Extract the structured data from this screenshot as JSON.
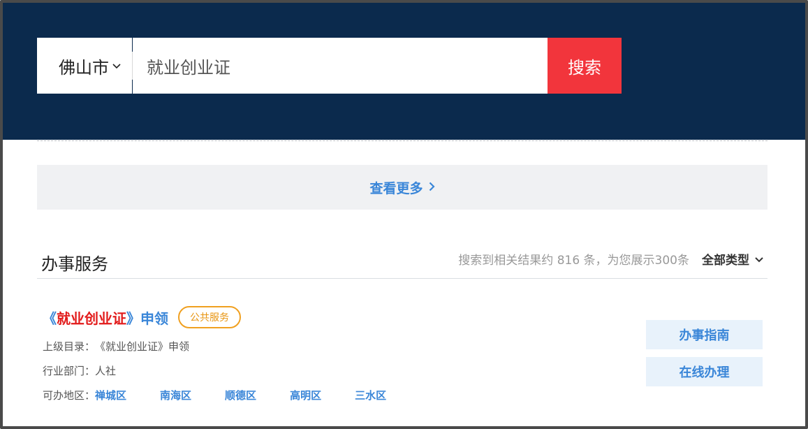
{
  "search": {
    "city": "佛山市",
    "query": "就业创业证",
    "button_label": "搜索"
  },
  "more": {
    "label": "查看更多"
  },
  "section": {
    "title": "办事服务",
    "result_summary": "搜索到相关结果约 816 条，为您展示300条",
    "type_filter": "全部类型"
  },
  "result": {
    "title_open": "《",
    "title_highlight": "就业创业证",
    "title_close": "》",
    "title_suffix": "申领",
    "tag": "公共服务",
    "parent_label": "上级目录：",
    "parent_value": "《就业创业证》申领",
    "dept_label": "行业部门：",
    "dept_value": "人社",
    "regions_label": "可办地区：",
    "regions": [
      "禅城区",
      "南海区",
      "顺德区",
      "高明区",
      "三水区"
    ],
    "guide_button": "办事指南",
    "online_button": "在线办理"
  },
  "colors": {
    "header_bg": "#0b2a4d",
    "search_button": "#f2353c",
    "link_blue": "#3a86d8",
    "highlight_red": "#e21b1b",
    "tag_orange": "#f0a020"
  },
  "icons": {
    "city_dropdown": "chevron-down-icon",
    "more_arrow": "chevron-right-icon",
    "type_dropdown": "chevron-down-icon"
  }
}
